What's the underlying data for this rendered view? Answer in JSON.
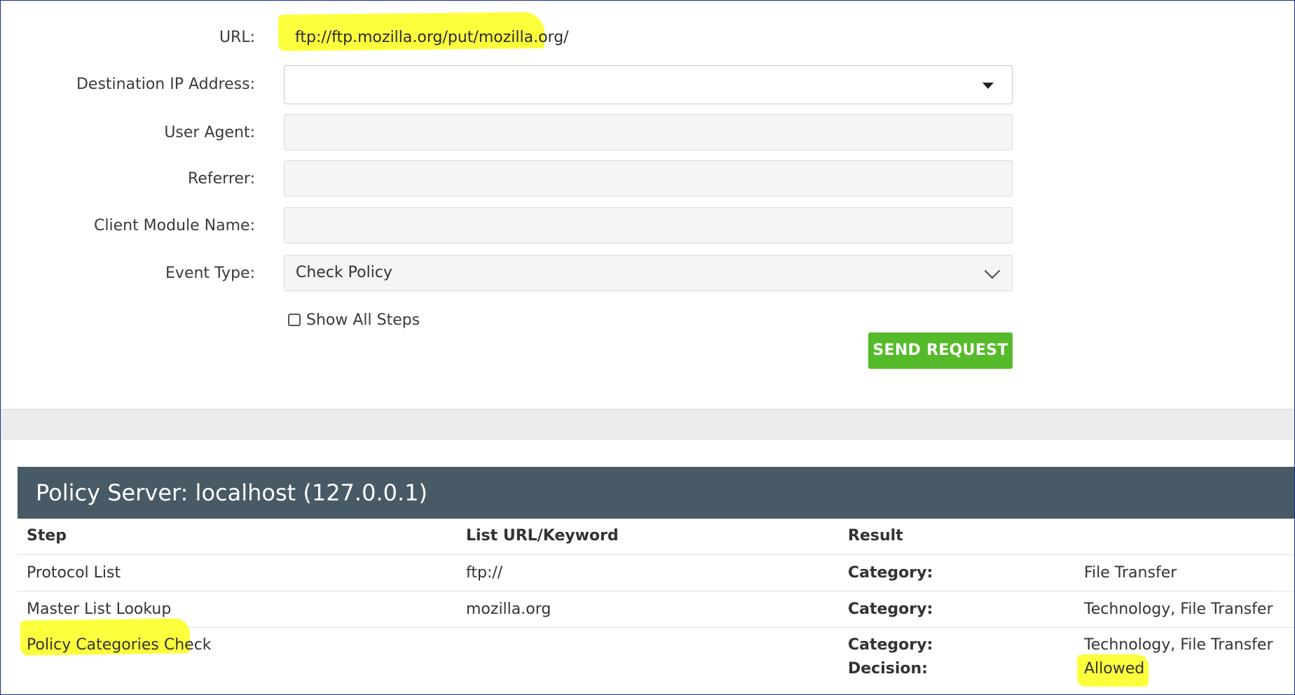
{
  "form": {
    "url_label": "URL:",
    "url_value": "ftp://ftp.mozilla.org/put/mozilla.org/",
    "dest_ip_label": "Destination IP Address:",
    "dest_ip_value": "",
    "user_agent_label": "User Agent:",
    "user_agent_value": "",
    "referrer_label": "Referrer:",
    "referrer_value": "",
    "client_module_label": "Client Module Name:",
    "client_module_value": "",
    "event_type_label": "Event Type:",
    "event_type_value": "Check Policy",
    "show_all_steps_label": "Show All Steps",
    "show_all_steps_checked": false,
    "send_button_label": "SEND REQUEST"
  },
  "results": {
    "title": "Policy Server: localhost (127.0.0.1)",
    "columns": {
      "step": "Step",
      "list_url": "List URL/Keyword",
      "result": "Result"
    },
    "rows": [
      {
        "step": "Protocol List",
        "list_url": "ftp://",
        "key1": "Category:",
        "val1": "File Transfer"
      },
      {
        "step": "Master List Lookup",
        "list_url": "mozilla.org",
        "key1": "Category:",
        "val1": "Technology, File Transfer"
      },
      {
        "step": "Policy Categories Check",
        "list_url": "",
        "key1": "Category:",
        "val1": "Technology, File Transfer",
        "key2": "Decision:",
        "val2": "Allowed"
      }
    ]
  },
  "colors": {
    "send_button": "#55bb2a",
    "header_bar": "#475a65",
    "highlight": "#fcff3c"
  }
}
